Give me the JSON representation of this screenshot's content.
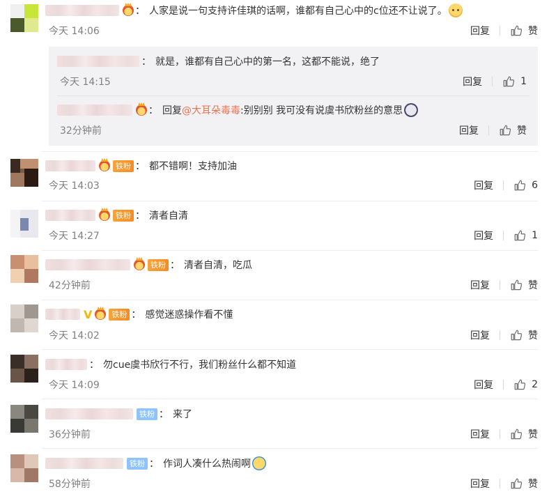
{
  "labels": {
    "reply": "回复",
    "like": "赞"
  },
  "comments": [
    {
      "text": "人家是说一句支持许佳琪的话啊，谁都有自己心中的c位还不让说了。",
      "time": "今天 14:06",
      "like_label": "赞",
      "replies": [
        {
          "text": "就是，谁都有自己心中的第一名，这都不能说，绝了",
          "time": "今天 14:15",
          "like_label": "1"
        },
        {
          "reply_prefix": "回复",
          "mention": "@大耳朵毒毒",
          "text": ":别别别 我可没有说虞书欣粉丝的意思",
          "time": "32分钟前",
          "like_label": "赞"
        }
      ]
    },
    {
      "badge": "铁粉",
      "text": "都不错啊！支持加油",
      "time": "今天 14:03",
      "like_label": "6"
    },
    {
      "badge": "铁粉",
      "text": "清者自清",
      "time": "今天 14:27",
      "like_label": "1"
    },
    {
      "badge": "铁粉",
      "text": "清者自清，吃瓜",
      "time": "42分钟前",
      "like_label": "赞"
    },
    {
      "badge": "铁粉",
      "text": "感觉迷惑操作看不懂",
      "time": "今天 14:02",
      "like_label": "赞"
    },
    {
      "text": "勿cue虞书欣行不行，我们粉丝什么都不知道",
      "time": "今天 14:09",
      "like_label": "2"
    },
    {
      "badge": "铁粉",
      "text": "来了",
      "time": "36分钟前",
      "like_label": "赞"
    },
    {
      "badge": "铁粉",
      "text": "作词人凑什么热闹啊",
      "time": "58分钟前",
      "like_label": "赞"
    }
  ],
  "colors": {
    "mention": "#eb7350",
    "time": "#808080",
    "badge_orange": "#f58b23",
    "badge_blue": "#8fc3ff",
    "reply_bg": "#f2f2f5"
  }
}
